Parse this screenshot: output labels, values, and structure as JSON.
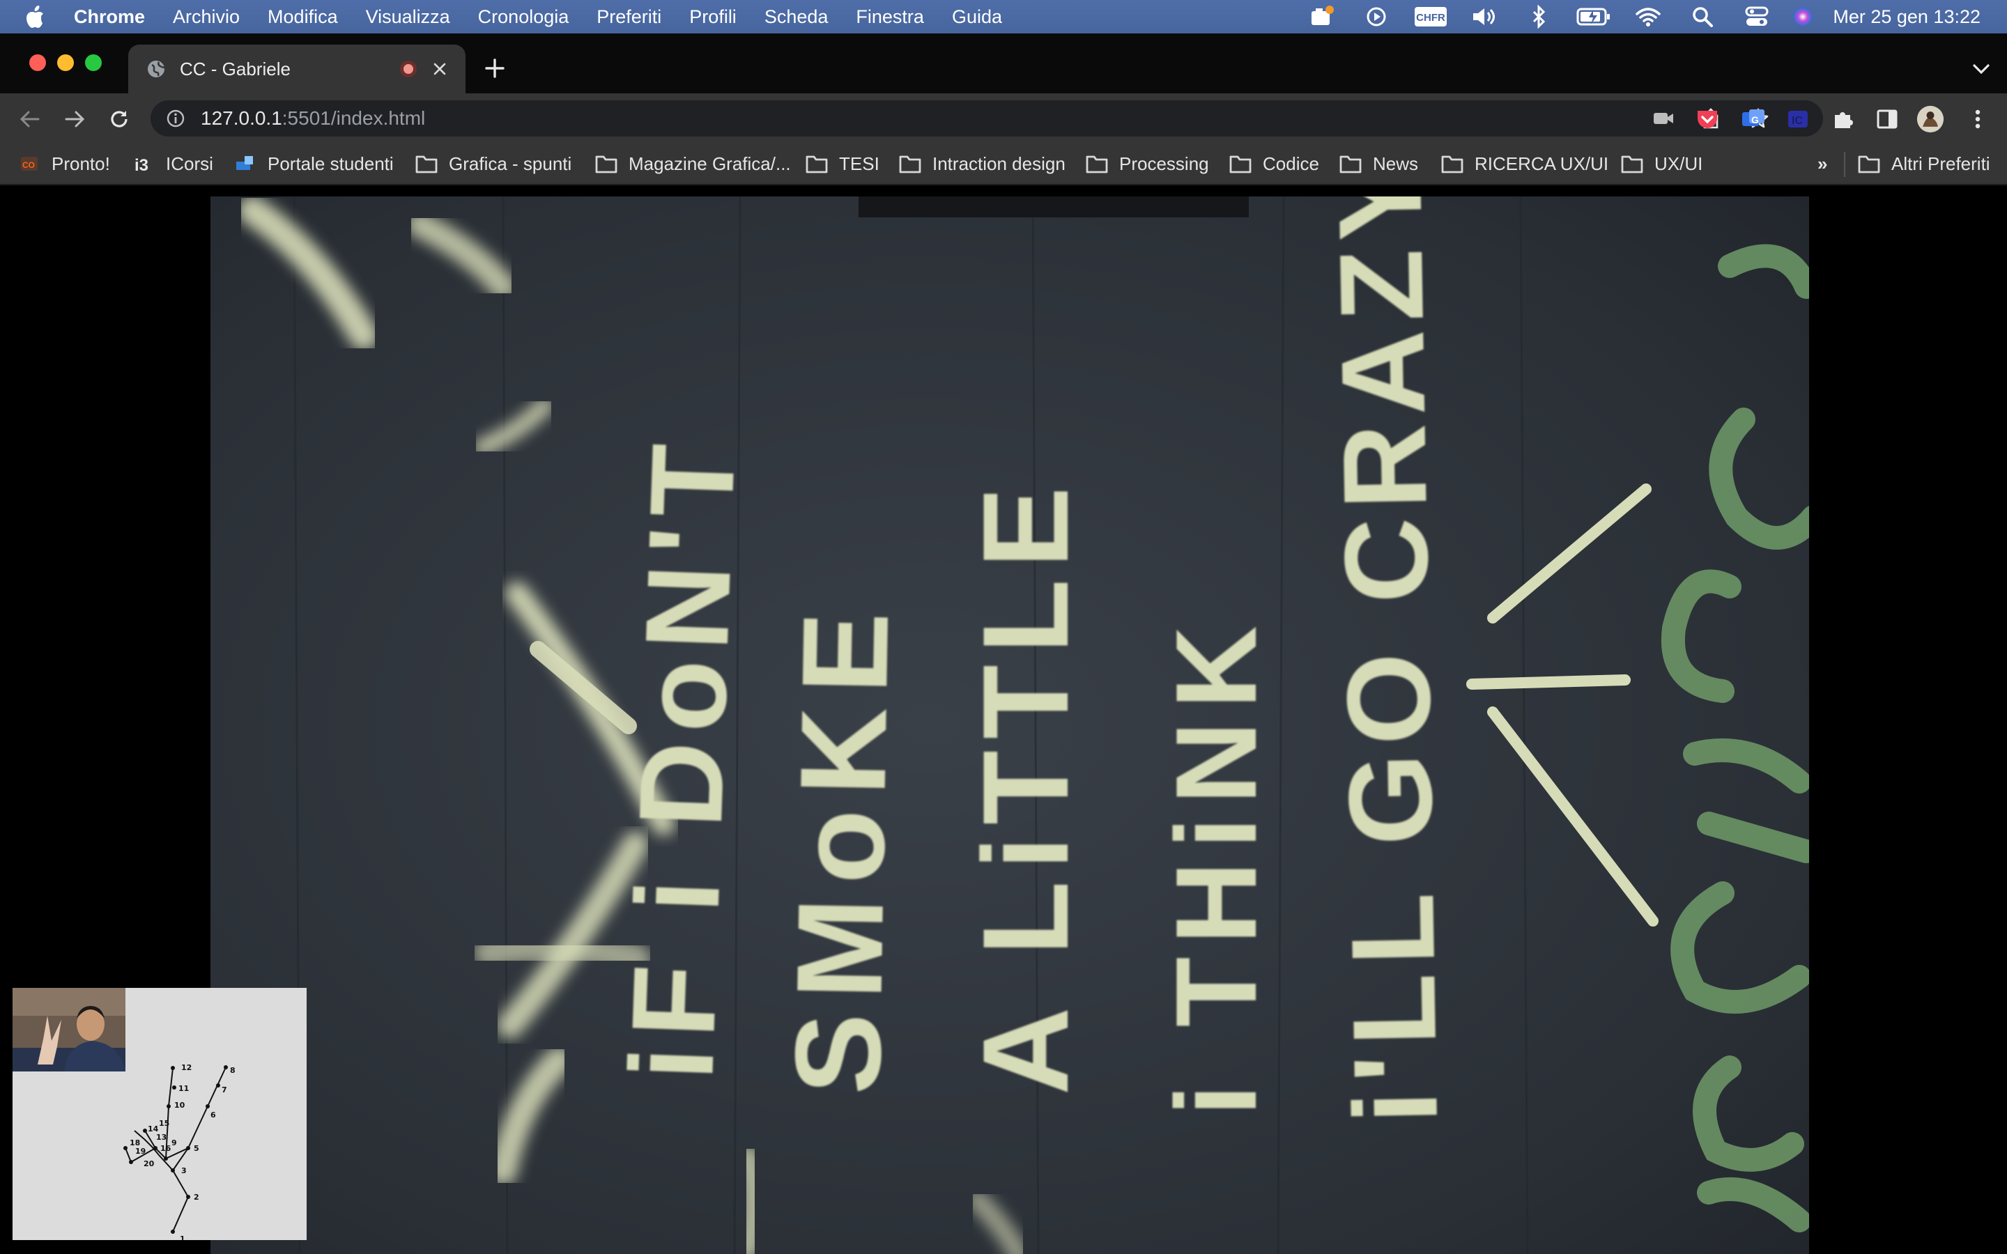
{
  "menubar": {
    "app_name": "Chrome",
    "menus": [
      "Archivio",
      "Modifica",
      "Visualizza",
      "Cronologia",
      "Preferiti",
      "Profili",
      "Scheda",
      "Finestra",
      "Guida"
    ],
    "status_icons": [
      "notification-icon",
      "play-icon",
      "input-source-icon",
      "volume-icon",
      "bluetooth-icon",
      "battery-icon",
      "wifi-icon",
      "spotlight-icon",
      "control-center-icon",
      "siri-icon"
    ],
    "input_source": "CHFR",
    "clock": "Mer 25 gen  13:22"
  },
  "tab": {
    "title": "CC - Gabriele"
  },
  "omnibox": {
    "host": "127.0.0.1",
    "path": ":5501/index.html"
  },
  "bookmarks": {
    "items": [
      {
        "label": "Pronto!",
        "icon": "pronto-favicon"
      },
      {
        "label": "ICorsi",
        "icon": "icorsi-favicon"
      },
      {
        "label": "Portale studenti",
        "icon": "portale-favicon"
      },
      {
        "label": "Grafica - spunti",
        "icon": "folder-icon"
      },
      {
        "label": "Magazine Grafica/...",
        "icon": "folder-icon"
      },
      {
        "label": "TESI",
        "icon": "folder-icon"
      },
      {
        "label": "Intraction design",
        "icon": "folder-icon"
      },
      {
        "label": "Processing",
        "icon": "folder-icon"
      },
      {
        "label": "Codice",
        "icon": "folder-icon"
      },
      {
        "label": "News",
        "icon": "folder-icon"
      },
      {
        "label": "RICERCA UX/UI",
        "icon": "folder-icon"
      },
      {
        "label": "UX/UI",
        "icon": "folder-icon"
      }
    ],
    "overflow": "»",
    "other": "Altri Preferiti"
  },
  "photo": {
    "graffiti_lines": [
      "iF i DoN'T",
      "SMoKE",
      "A LiTTLE",
      "i THiNK",
      "i'LL GO CRAZY"
    ]
  },
  "hand_sketch": {
    "landmark_labels": [
      "1",
      "2",
      "3",
      "5",
      "6",
      "7",
      "8",
      "9",
      "10",
      "11",
      "12",
      "13",
      "14",
      "15",
      "16",
      "18",
      "19",
      "20"
    ]
  },
  "colors": {
    "menubar": "#4a69a2",
    "tab_active": "#353535",
    "toolbar": "#353535",
    "omnibox": "#202124",
    "wall": "#2f343b",
    "chalk": "#d7dcb8",
    "green_paint": "#6f9a68",
    "sketch_bg": "#dcdcdc"
  }
}
